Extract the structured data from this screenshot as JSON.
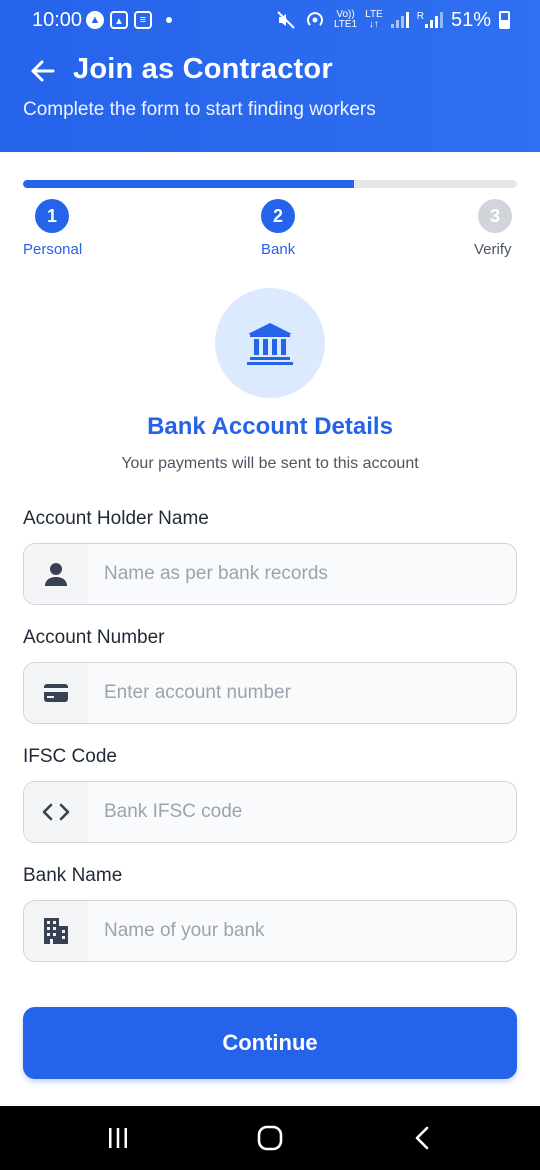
{
  "status_bar": {
    "time": "10:00",
    "network_top": "Vo))",
    "network_bottom": "LTE1",
    "lte_label": "LTE",
    "roaming_label": "R",
    "battery": "51%"
  },
  "header": {
    "title": "Join as Contractor",
    "subtitle": "Complete the form to start finding workers",
    "back_icon": "arrow-left-icon"
  },
  "progress": {
    "fraction": 0.67,
    "steps": [
      {
        "number": "1",
        "label": "Personal",
        "state": "complete"
      },
      {
        "number": "2",
        "label": "Bank",
        "state": "current"
      },
      {
        "number": "3",
        "label": "Verify",
        "state": "pending"
      }
    ]
  },
  "section": {
    "icon": "bank-icon",
    "title": "Bank Account Details",
    "subtitle": "Your payments will be sent to this account"
  },
  "form": {
    "fields": [
      {
        "label": "Account Holder Name",
        "placeholder": "Name as per bank records",
        "value": "",
        "icon": "person-icon"
      },
      {
        "label": "Account Number",
        "placeholder": "Enter account number",
        "value": "",
        "icon": "card-icon"
      },
      {
        "label": "IFSC Code",
        "placeholder": "Bank IFSC code",
        "value": "",
        "icon": "code-icon"
      },
      {
        "label": "Bank Name",
        "placeholder": "Name of your bank",
        "value": "",
        "icon": "building-icon"
      }
    ],
    "continue_label": "Continue"
  },
  "colors": {
    "primary": "#2563eb",
    "primary_light": "#dbeafe",
    "inactive": "#d1d5db"
  }
}
